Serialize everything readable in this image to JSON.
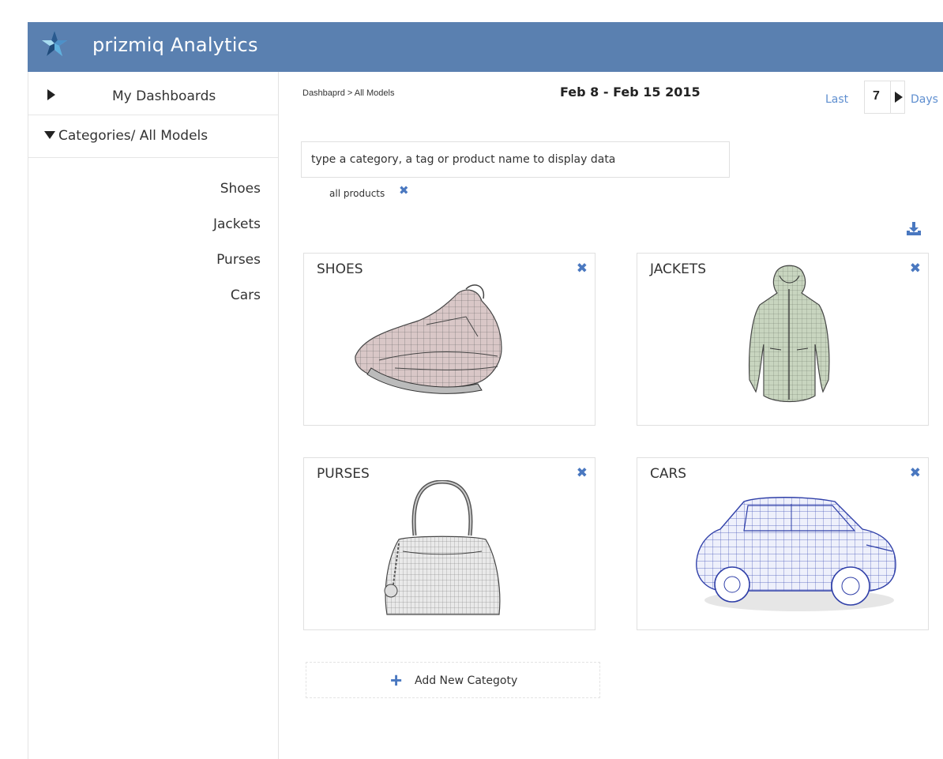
{
  "app": {
    "title": "prizmiq Analytics",
    "brand_color": "#5a80b0"
  },
  "sidebar": {
    "my_dashboards_label": "My Dashboards",
    "categories_label": "Categories/ All Models",
    "items": [
      {
        "label": "Shoes"
      },
      {
        "label": "Jackets"
      },
      {
        "label": "Purses"
      },
      {
        "label": "Cars"
      }
    ]
  },
  "toolbar": {
    "breadcrumb": "Dashbaprd > All Models",
    "date_range": "Feb 8 - Feb 15 2015",
    "last_label": "Last",
    "days_value": "7",
    "days_label": "Days"
  },
  "search": {
    "placeholder": "type a category, a tag or product name to display data"
  },
  "filter_tag": {
    "label": "all products",
    "remove_symbol": "✖"
  },
  "cards": [
    {
      "title": "SHOES",
      "close_symbol": "✖",
      "image": "shoe-wireframe"
    },
    {
      "title": "JACKETS",
      "close_symbol": "✖",
      "image": "jacket-wireframe"
    },
    {
      "title": "PURSES",
      "close_symbol": "✖",
      "image": "purse-wireframe"
    },
    {
      "title": "CARS",
      "close_symbol": "✖",
      "image": "car-wireframe"
    }
  ],
  "add_category": {
    "plus_symbol": "+",
    "label": "Add New Categoty"
  },
  "accent_color": "#4a78c0",
  "link_color": "#5f8fd0"
}
